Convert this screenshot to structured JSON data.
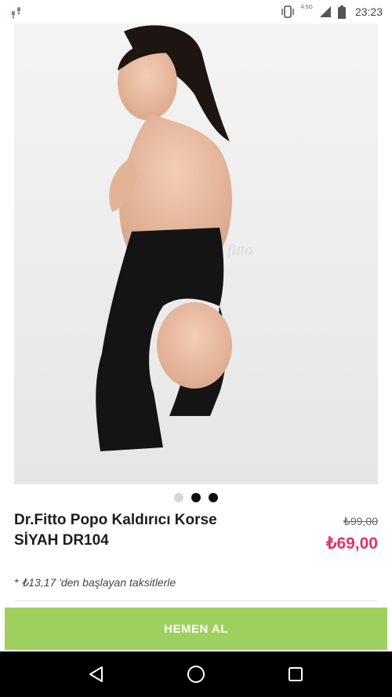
{
  "status_bar": {
    "time": "23:23",
    "network": "4.5G"
  },
  "product": {
    "image_alt": "",
    "title": "Dr.Fitto Popo Kaldırıcı Korse\nSİYAH DR104",
    "old_price": "₺99,00",
    "new_price": "₺69,00",
    "installment_note": "* ₺13,17 'den başlayan taksitlerle"
  },
  "carousel": {
    "count": 3,
    "active_index": 0
  },
  "actions": {
    "buy_label": "HEMEN AL"
  },
  "colors": {
    "price": "#e0336e",
    "buy_button": "#9fd05f"
  }
}
